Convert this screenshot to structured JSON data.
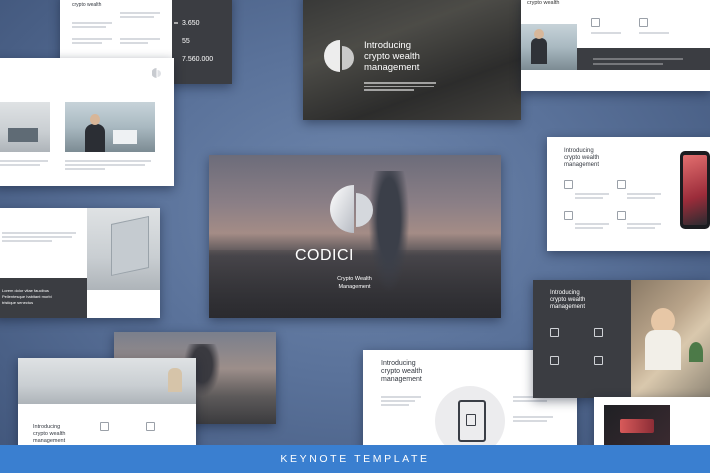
{
  "center": {
    "brand": "CODICI",
    "subtitle_line1": "Crypto Wealth",
    "subtitle_line2": "Management"
  },
  "intro": {
    "line1": "Introducing",
    "line2": "crypto wealth",
    "line3": "management"
  },
  "stats": {
    "stat1": "3.650",
    "stat2": "55",
    "stat3": "7.560.000"
  },
  "footer": {
    "label": "KEYNOTE TEMPLATE"
  },
  "misc": {
    "lorem_left": "Lorem dolor vitae faucibus",
    "lorem_left2": "Pellentesque habitant morbi",
    "lorem_left3": "tristique senectus"
  },
  "colors": {
    "background": "#5a729a",
    "footer": "#3a7fd0",
    "accent_dark": "#3b3d42"
  }
}
